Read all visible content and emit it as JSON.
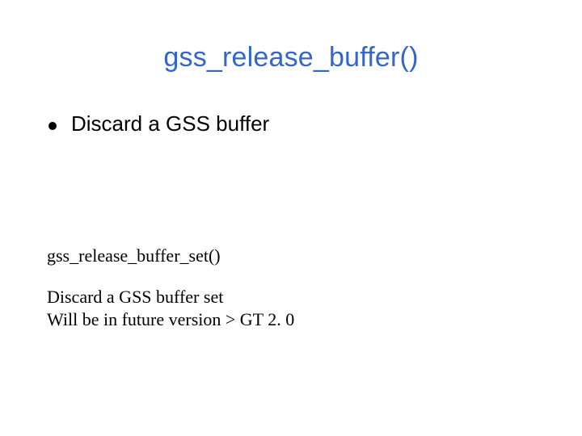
{
  "title": "gss_release_buffer()",
  "bullet": {
    "text": "Discard a GSS buffer"
  },
  "sub": {
    "heading": "gss_release_buffer_set()",
    "body": "Discard a GSS buffer set\nWill be in future version > GT 2. 0"
  }
}
